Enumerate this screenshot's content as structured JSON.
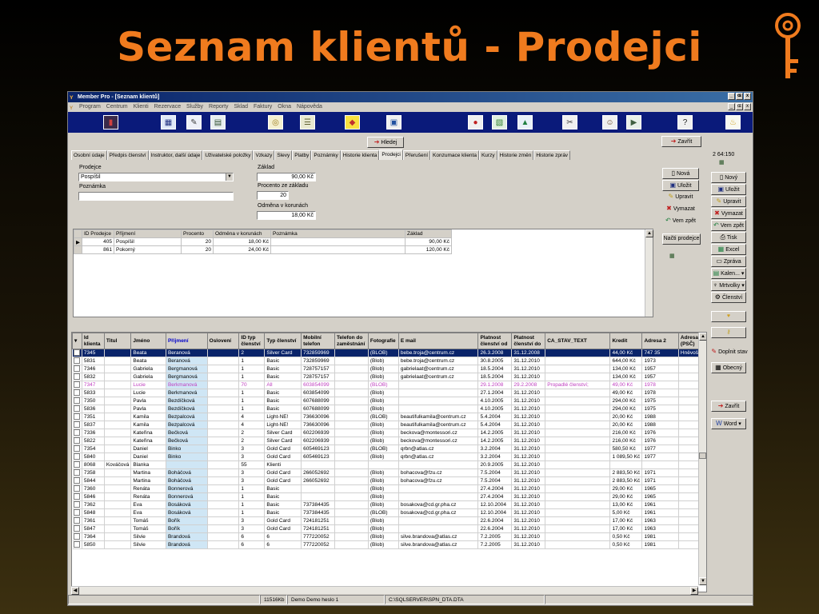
{
  "slide": {
    "title": "Seznam klientů - Prodejci"
  },
  "window": {
    "title": "Member Pro - [Seznam klientů]",
    "controls": [
      "_",
      "ɶ",
      "x"
    ]
  },
  "menu": [
    "Program",
    "Centrum",
    "Klienti",
    "Rezervace",
    "Služby",
    "Reporty",
    "Sklad",
    "Faktury",
    "Okna",
    "Nápověda"
  ],
  "toolbar_icons": [
    "door-icon",
    "calendar-icon",
    "edit-icon",
    "chart-icon",
    "coins-icon",
    "list-icon",
    "palette-icon",
    "gifts-icon",
    "stop-icon",
    "card-icon",
    "graph-icon",
    "tools-icon",
    "doctor-icon",
    "delivery-icon",
    "help-icon",
    "bulb-icon"
  ],
  "top_buttons": {
    "search": "Hledej",
    "close": "Zavřít"
  },
  "side_info": "2 64:150",
  "tabs": [
    "Osobní údaje",
    "Předpis členství",
    "Instruktor, další údaje",
    "Uživatelské položky",
    "Vzkazy",
    "Slevy",
    "Platby",
    "Poznámky",
    "Historie klienta",
    "Prodejci",
    "Přerušení",
    "Konzumace klienta",
    "Kurzy",
    "Historie změn",
    "Historie zpráv"
  ],
  "active_tab": "Prodejci",
  "form": {
    "prodejce_label": "Prodejce",
    "prodejce_value": "Pospíšil",
    "poznamka_label": "Poznámka",
    "poznamka_value": "",
    "zaklad_label": "Základ",
    "zaklad_value": "90,00 Kč",
    "procento_label": "Procento ze základu",
    "procento_value": "20",
    "odmena_label": "Odměna v korunách",
    "odmena_value": "18,00 Kč"
  },
  "panel_buttons": {
    "new": "Nová",
    "save": "Uložit",
    "edit": "Upravit",
    "delete": "Vymazat",
    "back": "Vem zpět",
    "load": "Načti prodejce"
  },
  "sub_grid": {
    "columns": [
      "ID Prodejce",
      "Příjmení",
      "Procento",
      "Odměna v korunách",
      "Poznámka",
      "Základ"
    ],
    "rows": [
      [
        "405",
        "Pospíšil",
        "20",
        "18,00 Kč",
        "",
        "90,00 Kč"
      ],
      [
        "861",
        "Pokorný",
        "20",
        "24,00 Kč",
        "",
        "120,00 Kč"
      ]
    ]
  },
  "right_buttons": {
    "new": "Nový",
    "save": "Uložit",
    "edit": "Upravit",
    "delete": "Vymazat",
    "back": "Vem zpět",
    "print": "Tisk",
    "excel": "Excel",
    "message": "Zpráva",
    "calendar": "Kalen...",
    "deadlines": "Mrtvolky",
    "membership": "Členství",
    "fill": "Doplnit stav",
    "general": "Obecný",
    "close": "Zavřít",
    "word": "Word"
  },
  "grid": {
    "columns": [
      "Id klienta",
      "Titul",
      "Jméno",
      "Příjmení",
      "Oslovení",
      "ID typ členství",
      "Typ členství",
      "Mobilní telefon",
      "Telefon do zaměstnání",
      "Fotografie",
      "E mail",
      "Platnost členství od",
      "Platnost členství do",
      "CA_STAV_TEXT",
      "Kredit",
      "Adresa 2",
      "Adresa (PSČ)"
    ],
    "rows": [
      [
        "7345",
        "",
        "Beata",
        "Beranová",
        "",
        "2",
        "Silver Card",
        "732859969",
        "",
        "(BLOB)",
        "bebe.troja@centrum.cz",
        "26.3.2008",
        "31.12.2008",
        "",
        "44,00 Kč",
        "747 35",
        "Hněvošic"
      ],
      [
        "5831",
        "",
        "Beata",
        "Beranová",
        "",
        "1",
        "Basic",
        "732859969",
        "",
        "(Blob)",
        "bebe.troja@centrum.cz",
        "30.8.2005",
        "31.12.2010",
        "",
        "644,00 Kč",
        "1973",
        ""
      ],
      [
        "7346",
        "",
        "Gabriela",
        "Bergmanová",
        "",
        "1",
        "Basic",
        "728757157",
        "",
        "(Blob)",
        "gabrielaat@centrum.cz",
        "18.5.2004",
        "31.12.2010",
        "",
        "134,00 Kč",
        "1957",
        ""
      ],
      [
        "5832",
        "",
        "Gabriela",
        "Bergmanová",
        "",
        "1",
        "Basic",
        "728757157",
        "",
        "(Blob)",
        "gabrielaat@centrum.cz",
        "18.5.2004",
        "31.12.2010",
        "",
        "134,00 Kč",
        "1957",
        ""
      ],
      [
        "7347",
        "",
        "Lucie",
        "Berkmanová",
        "",
        "70",
        "All",
        "603854099",
        "",
        "(BLOB)",
        "",
        "29.1.2008",
        "29.2.2008",
        "Propadlé členství;",
        "49,00 Kč",
        "1978",
        ""
      ],
      [
        "5833",
        "",
        "Lucie",
        "Berkmanová",
        "",
        "1",
        "Basic",
        "603854099",
        "",
        "(Blob)",
        "",
        "27.1.2004",
        "31.12.2010",
        "",
        "49,00 Kč",
        "1978",
        ""
      ],
      [
        "7350",
        "",
        "Pavla",
        "Bezdíčková",
        "",
        "1",
        "Basic",
        "607688099",
        "",
        "(Blob)",
        "",
        "4.10.2005",
        "31.12.2010",
        "",
        "294,00 Kč",
        "1975",
        ""
      ],
      [
        "5836",
        "",
        "Pavla",
        "Bezdíčková",
        "",
        "1",
        "Basic",
        "607688099",
        "",
        "(Blob)",
        "",
        "4.10.2005",
        "31.12.2010",
        "",
        "294,00 Kč",
        "1975",
        ""
      ],
      [
        "7351",
        "",
        "Kamila",
        "Bezpalcová",
        "",
        "4",
        "Light-NE!",
        "736630096",
        "",
        "(BLOB)",
        "beautifulkamila@centrum.cz",
        "5.4.2004",
        "31.12.2010",
        "",
        "20,00 Kč",
        "1988",
        ""
      ],
      [
        "5837",
        "",
        "Kamila",
        "Bezpalcová",
        "",
        "4",
        "Light-NE!",
        "736630096",
        "",
        "(Blob)",
        "beautifulkamila@centrum.cz",
        "5.4.2004",
        "31.12.2010",
        "",
        "20,00 Kč",
        "1988",
        ""
      ],
      [
        "7336",
        "",
        "Kateřina",
        "Bečková",
        "",
        "2",
        "Silver Card",
        "602206939",
        "",
        "(Blob)",
        "beckova@montessori.cz",
        "14.2.2005",
        "31.12.2010",
        "",
        "216,00 Kč",
        "1976",
        ""
      ],
      [
        "5822",
        "",
        "Kateřina",
        "Bečková",
        "",
        "2",
        "Silver Card",
        "602206939",
        "",
        "(Blob)",
        "beckova@montessori.cz",
        "14.2.2005",
        "31.12.2010",
        "",
        "216,00 Kč",
        "1976",
        ""
      ],
      [
        "7354",
        "",
        "Daniel",
        "Binko",
        "",
        "3",
        "Gold Card",
        "605469123",
        "",
        "(BLOB)",
        "qrbn@atlas.cz",
        "3.2.2004",
        "31.12.2010",
        "",
        "580,50 Kč",
        "1977",
        ""
      ],
      [
        "5840",
        "",
        "Daniel",
        "Binko",
        "",
        "3",
        "Gold Card",
        "605469123",
        "",
        "(Blob)",
        "qrbn@atlas.cz",
        "3.2.2004",
        "31.12.2010",
        "",
        "1 089,50 Kč",
        "1977",
        ""
      ],
      [
        "8068",
        "Kováčová",
        "Blanka",
        "",
        "",
        "55",
        "Klienti",
        "",
        "",
        "",
        "",
        "20.9.2005",
        "31.12.2010",
        "",
        "",
        "",
        ""
      ],
      [
        "7358",
        "",
        "Martina",
        "Boháčová",
        "",
        "3",
        "Gold Card",
        "266052692",
        "",
        "(Blob)",
        "bohacova@fzu.cz",
        "7.5.2004",
        "31.12.2010",
        "",
        "2 883,50 Kč",
        "1971",
        ""
      ],
      [
        "5844",
        "",
        "Martina",
        "Boháčová",
        "",
        "3",
        "Gold Card",
        "266052692",
        "",
        "(Blob)",
        "bohacova@fzu.cz",
        "7.5.2004",
        "31.12.2010",
        "",
        "2 883,50 Kč",
        "1971",
        ""
      ],
      [
        "7360",
        "",
        "Renáta",
        "Bonnerová",
        "",
        "1",
        "Basic",
        "",
        "",
        "(Blob)",
        "",
        "27.4.2004",
        "31.12.2010",
        "",
        "29,00 Kč",
        "1965",
        ""
      ],
      [
        "5846",
        "",
        "Renáta",
        "Bonnerová",
        "",
        "1",
        "Basic",
        "",
        "",
        "(Blob)",
        "",
        "27.4.2004",
        "31.12.2010",
        "",
        "29,00 Kč",
        "1965",
        ""
      ],
      [
        "7362",
        "",
        "Eva",
        "Bosáková",
        "",
        "1",
        "Basic",
        "737384435",
        "",
        "(Blob)",
        "bosakova@cd.gr.pha.cz",
        "12.10.2004",
        "31.12.2010",
        "",
        "13,00 Kč",
        "1961",
        ""
      ],
      [
        "5848",
        "",
        "Eva",
        "Bosáková",
        "",
        "1",
        "Basic",
        "737384435",
        "",
        "(BLOB)",
        "bosakova@cd.gr.pha.cz",
        "12.10.2004",
        "31.12.2010",
        "",
        "5,00 Kč",
        "1961",
        ""
      ],
      [
        "7361",
        "",
        "Tomáš",
        "Bořík",
        "",
        "3",
        "Gold Card",
        "724181251",
        "",
        "(Blob)",
        "",
        "22.6.2004",
        "31.12.2010",
        "",
        "17,00 Kč",
        "1963",
        ""
      ],
      [
        "5847",
        "",
        "Tomáš",
        "Bořík",
        "",
        "3",
        "Gold Card",
        "724181251",
        "",
        "(Blob)",
        "",
        "22.6.2004",
        "31.12.2010",
        "",
        "17,00 Kč",
        "1963",
        ""
      ],
      [
        "7364",
        "",
        "Silvie",
        "Brandová",
        "",
        "6",
        "6",
        "777220052",
        "",
        "(Blob)",
        "silve.brandova@atlas.cz",
        "7.2.2005",
        "31.12.2010",
        "",
        "0,50 Kč",
        "1981",
        ""
      ],
      [
        "5850",
        "",
        "Silvie",
        "Brandová",
        "",
        "6",
        "6",
        "777220052",
        "",
        "(Blob)",
        "silve.brandova@atlas.cz",
        "7.2.2005",
        "31.12.2010",
        "",
        "0,50 Kč",
        "1981",
        ""
      ]
    ]
  },
  "status": [
    "",
    "11516Kb",
    "Demo Demo heslo 1",
    "C:\\SQLSERVER\\SPN_DTA.DTA",
    ""
  ]
}
